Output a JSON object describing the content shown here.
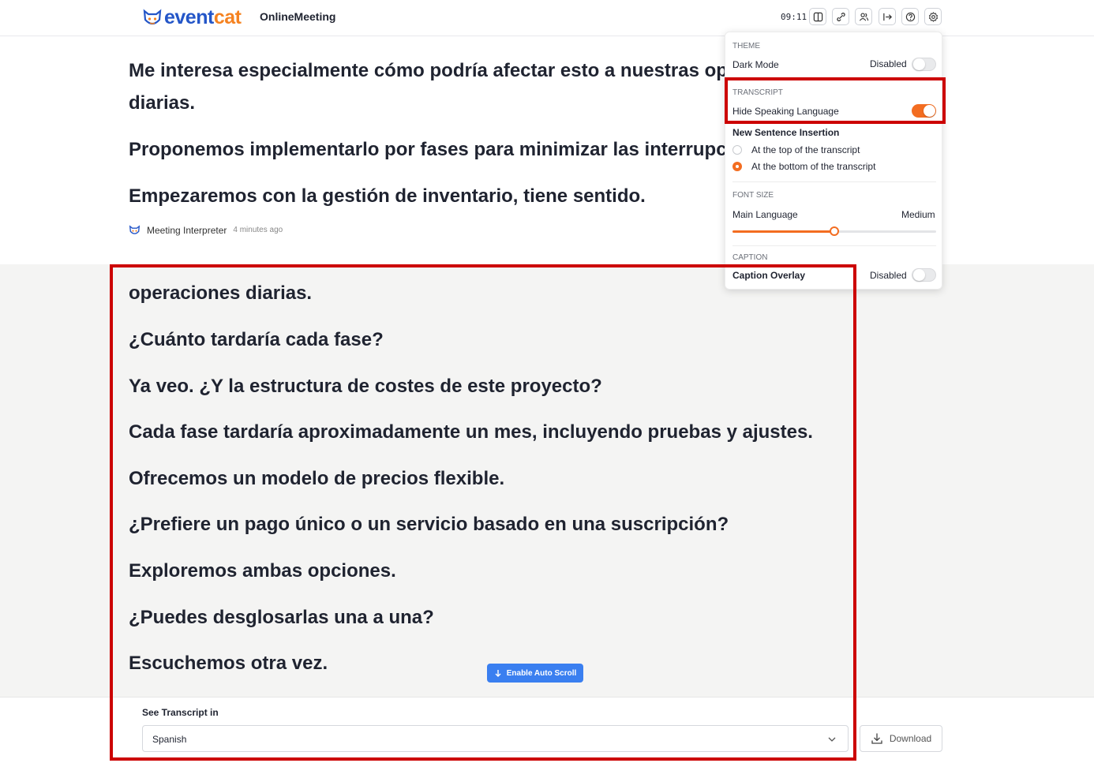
{
  "header": {
    "logo_text_a": "event",
    "logo_text_b": "cat",
    "app_name": "OnlineMeeting",
    "clock": "09:11",
    "buttons": [
      "split-view-icon",
      "link-icon",
      "users-icon",
      "exit-icon",
      "help-icon",
      "settings-icon"
    ]
  },
  "upper_transcript": {
    "lines": [
      "Me interesa especialmente cómo podría afectar esto a nuestras operaciones",
      "diarias.",
      "Proponemos implementarlo por fases para minimizar las interrupciones.",
      "Empezaremos con la gestión de inventario, tiene sentido."
    ],
    "speaker": "Meeting Interpreter",
    "time_ago": "4 minutes ago"
  },
  "lower_transcript": {
    "lines": [
      "operaciones diarias.",
      "¿Cuánto tardaría cada fase?",
      "Ya veo. ¿Y la estructura de costes de este proyecto?",
      "Cada fase tardaría aproximadamente un mes, incluyendo pruebas y ajustes.",
      "Ofrecemos un modelo de precios flexible.",
      "¿Prefiere un pago único o un servicio basado en una suscripción?",
      "Exploremos ambas opciones.",
      "¿Puedes desglosarlas una a una?",
      "Escuchemos otra vez."
    ],
    "auto_scroll_label": "Enable Auto Scroll"
  },
  "footer": {
    "see_label": "See Transcript in",
    "language": "Spanish",
    "download_label": "Download"
  },
  "settings": {
    "theme_title": "THEME",
    "dark_mode_label": "Dark Mode",
    "dark_mode_state": "Disabled",
    "transcript_title": "TRANSCRIPT",
    "hide_lang_label": "Hide Speaking Language",
    "hide_lang_on": true,
    "insertion_label": "New Sentence Insertion",
    "insertion_top": "At the top of the transcript",
    "insertion_bottom": "At the bottom of the transcript",
    "insertion_selected": "bottom",
    "font_title": "FONT SIZE",
    "main_lang_label": "Main Language",
    "main_lang_size": "Medium",
    "font_slider_fraction": 0.5,
    "caption_title": "CAPTION",
    "caption_label": "Caption Overlay",
    "caption_state": "Disabled"
  },
  "colors": {
    "accent_orange": "#f36d21",
    "brand_blue": "#2456c8",
    "highlight_red": "#cc0000",
    "auto_scroll_blue": "#3a7ff0"
  }
}
